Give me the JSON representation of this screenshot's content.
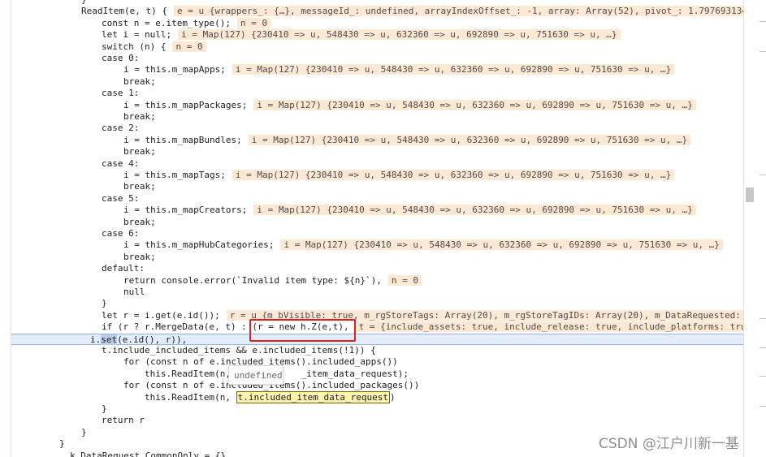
{
  "code_lines": [
    {
      "text": "}"
    },
    {
      "text": "ReadItem(e, t) {",
      "eval": "e = u {wrappers_: {…}, messageId_: undefined, arrayIndexOffset_: -1, array: Array(52), pivot_: 1.797693134"
    },
    {
      "text": "const n = e.item_type();",
      "eval": "n = 0"
    },
    {
      "text": "let i = null;",
      "eval": "i = Map(127) {230410 => u, 548430 => u, 632360 => u, 692890 => u, 751630 => u, …}"
    },
    {
      "text": "switch (n) {",
      "eval": "n = 0"
    },
    {
      "text": "case 0:"
    },
    {
      "text": "i = this.m_mapApps;",
      "eval": "i = Map(127) {230410 => u, 548430 => u, 632360 => u, 692890 => u, 751630 => u, …}"
    },
    {
      "text": "break;"
    },
    {
      "text": "case 1:"
    },
    {
      "text": "i = this.m_mapPackages;",
      "eval": "i = Map(127) {230410 => u, 548430 => u, 632360 => u, 692890 => u, 751630 => u, …}"
    },
    {
      "text": "break;"
    },
    {
      "text": "case 2:"
    },
    {
      "text": "i = this.m_mapBundles;",
      "eval": "i = Map(127) {230410 => u, 548430 => u, 632360 => u, 692890 => u, 751630 => u, …}"
    },
    {
      "text": "break;"
    },
    {
      "text": "case 4:"
    },
    {
      "text": "i = this.m_mapTags;",
      "eval": "i = Map(127) {230410 => u, 548430 => u, 632360 => u, 692890 => u, 751630 => u, …}"
    },
    {
      "text": "break;"
    },
    {
      "text": "case 5:"
    },
    {
      "text": "i = this.m_mapCreators;",
      "eval": "i = Map(127) {230410 => u, 548430 => u, 632360 => u, 692890 => u, 751630 => u, …}"
    },
    {
      "text": "break;"
    },
    {
      "text": "case 6:"
    },
    {
      "text": "i = this.m_mapHubCategories;",
      "eval": "i = Map(127) {230410 => u, 548430 => u, 632360 => u, 692890 => u, 751630 => u, …}"
    },
    {
      "text": "break;"
    },
    {
      "text": "default:"
    },
    {
      "text": "return console.error(`Invalid item type: ${n}`),",
      "eval": "n = 0"
    },
    {
      "text": "null"
    },
    {
      "text": "}"
    },
    {
      "text": "let r = i.get(e.id());",
      "eval": "r = u {m_bVisible: true, m_rgStoreTags: Array(20), m_rgStoreTagIDs: Array(20), m_DataRequested:"
    },
    {
      "text": "if (r ? r.MergeData(e, t) : (r = new h.Z(e,t),",
      "eval": "t = {include_assets: true, include_release: true, include_platforms: tru"
    },
    {
      "text_pre": "i.",
      "text_hl": "set",
      "text_post": "(e.id(), r)),"
    },
    {
      "text": "t.include_included_items && e.included_items(!1)) {"
    },
    {
      "text": "for (const n of e.included_items().included_apps())"
    },
    {
      "text_pre": "this.ReadItem(n, ",
      "text_post": "_item_data_request);"
    },
    {
      "text": "for (const n of e.included_items().included_packages())"
    },
    {
      "text_pre": "this.ReadItem(n, ",
      "text_hl2": "t.included_item_data_request",
      "text_post": ")"
    },
    {
      "text": "}"
    },
    {
      "text": "return r"
    },
    {
      "text": "}"
    },
    {
      "text": "}"
    },
    {
      "text": "k.DataRequest CommonOnly = {}"
    }
  ],
  "tooltip_text": "undefined",
  "watermark": "CSDN @江户川新一基"
}
